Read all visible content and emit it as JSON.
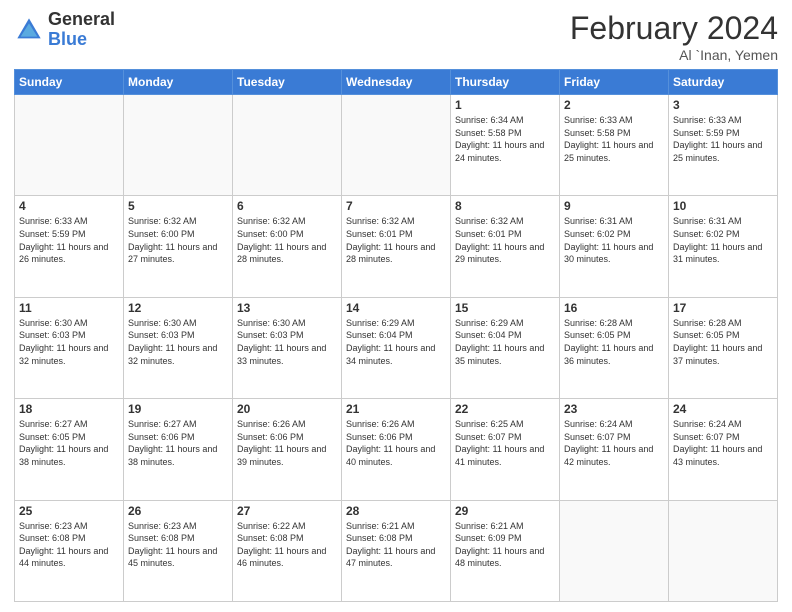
{
  "logo": {
    "general": "General",
    "blue": "Blue"
  },
  "title": "February 2024",
  "location": "Al `Inan, Yemen",
  "days_of_week": [
    "Sunday",
    "Monday",
    "Tuesday",
    "Wednesday",
    "Thursday",
    "Friday",
    "Saturday"
  ],
  "weeks": [
    [
      {
        "day": "",
        "info": ""
      },
      {
        "day": "",
        "info": ""
      },
      {
        "day": "",
        "info": ""
      },
      {
        "day": "",
        "info": ""
      },
      {
        "day": "1",
        "info": "Sunrise: 6:34 AM\nSunset: 5:58 PM\nDaylight: 11 hours and 24 minutes."
      },
      {
        "day": "2",
        "info": "Sunrise: 6:33 AM\nSunset: 5:58 PM\nDaylight: 11 hours and 25 minutes."
      },
      {
        "day": "3",
        "info": "Sunrise: 6:33 AM\nSunset: 5:59 PM\nDaylight: 11 hours and 25 minutes."
      }
    ],
    [
      {
        "day": "4",
        "info": "Sunrise: 6:33 AM\nSunset: 5:59 PM\nDaylight: 11 hours and 26 minutes."
      },
      {
        "day": "5",
        "info": "Sunrise: 6:32 AM\nSunset: 6:00 PM\nDaylight: 11 hours and 27 minutes."
      },
      {
        "day": "6",
        "info": "Sunrise: 6:32 AM\nSunset: 6:00 PM\nDaylight: 11 hours and 28 minutes."
      },
      {
        "day": "7",
        "info": "Sunrise: 6:32 AM\nSunset: 6:01 PM\nDaylight: 11 hours and 28 minutes."
      },
      {
        "day": "8",
        "info": "Sunrise: 6:32 AM\nSunset: 6:01 PM\nDaylight: 11 hours and 29 minutes."
      },
      {
        "day": "9",
        "info": "Sunrise: 6:31 AM\nSunset: 6:02 PM\nDaylight: 11 hours and 30 minutes."
      },
      {
        "day": "10",
        "info": "Sunrise: 6:31 AM\nSunset: 6:02 PM\nDaylight: 11 hours and 31 minutes."
      }
    ],
    [
      {
        "day": "11",
        "info": "Sunrise: 6:30 AM\nSunset: 6:03 PM\nDaylight: 11 hours and 32 minutes."
      },
      {
        "day": "12",
        "info": "Sunrise: 6:30 AM\nSunset: 6:03 PM\nDaylight: 11 hours and 32 minutes."
      },
      {
        "day": "13",
        "info": "Sunrise: 6:30 AM\nSunset: 6:03 PM\nDaylight: 11 hours and 33 minutes."
      },
      {
        "day": "14",
        "info": "Sunrise: 6:29 AM\nSunset: 6:04 PM\nDaylight: 11 hours and 34 minutes."
      },
      {
        "day": "15",
        "info": "Sunrise: 6:29 AM\nSunset: 6:04 PM\nDaylight: 11 hours and 35 minutes."
      },
      {
        "day": "16",
        "info": "Sunrise: 6:28 AM\nSunset: 6:05 PM\nDaylight: 11 hours and 36 minutes."
      },
      {
        "day": "17",
        "info": "Sunrise: 6:28 AM\nSunset: 6:05 PM\nDaylight: 11 hours and 37 minutes."
      }
    ],
    [
      {
        "day": "18",
        "info": "Sunrise: 6:27 AM\nSunset: 6:05 PM\nDaylight: 11 hours and 38 minutes."
      },
      {
        "day": "19",
        "info": "Sunrise: 6:27 AM\nSunset: 6:06 PM\nDaylight: 11 hours and 38 minutes."
      },
      {
        "day": "20",
        "info": "Sunrise: 6:26 AM\nSunset: 6:06 PM\nDaylight: 11 hours and 39 minutes."
      },
      {
        "day": "21",
        "info": "Sunrise: 6:26 AM\nSunset: 6:06 PM\nDaylight: 11 hours and 40 minutes."
      },
      {
        "day": "22",
        "info": "Sunrise: 6:25 AM\nSunset: 6:07 PM\nDaylight: 11 hours and 41 minutes."
      },
      {
        "day": "23",
        "info": "Sunrise: 6:24 AM\nSunset: 6:07 PM\nDaylight: 11 hours and 42 minutes."
      },
      {
        "day": "24",
        "info": "Sunrise: 6:24 AM\nSunset: 6:07 PM\nDaylight: 11 hours and 43 minutes."
      }
    ],
    [
      {
        "day": "25",
        "info": "Sunrise: 6:23 AM\nSunset: 6:08 PM\nDaylight: 11 hours and 44 minutes."
      },
      {
        "day": "26",
        "info": "Sunrise: 6:23 AM\nSunset: 6:08 PM\nDaylight: 11 hours and 45 minutes."
      },
      {
        "day": "27",
        "info": "Sunrise: 6:22 AM\nSunset: 6:08 PM\nDaylight: 11 hours and 46 minutes."
      },
      {
        "day": "28",
        "info": "Sunrise: 6:21 AM\nSunset: 6:08 PM\nDaylight: 11 hours and 47 minutes."
      },
      {
        "day": "29",
        "info": "Sunrise: 6:21 AM\nSunset: 6:09 PM\nDaylight: 11 hours and 48 minutes."
      },
      {
        "day": "",
        "info": ""
      },
      {
        "day": "",
        "info": ""
      }
    ]
  ]
}
